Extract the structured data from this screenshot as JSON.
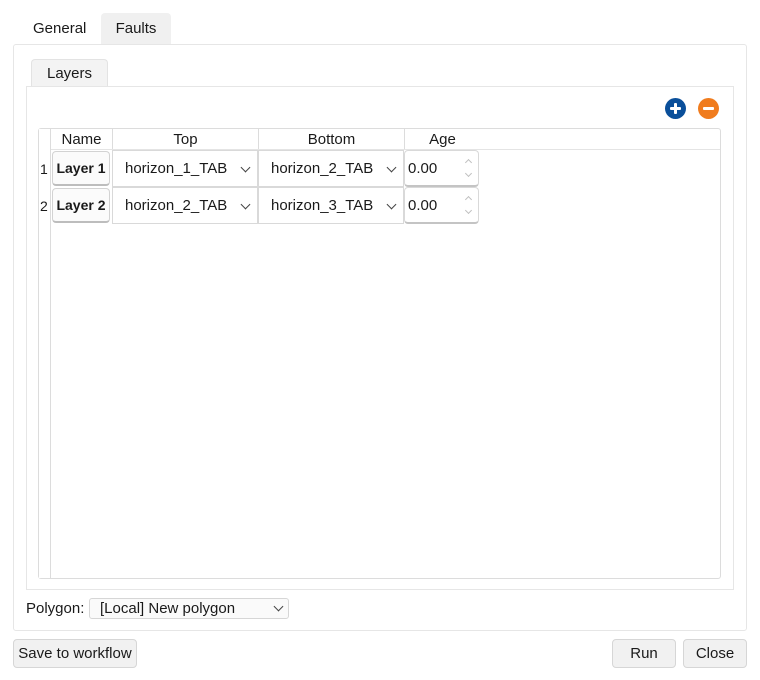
{
  "tabs": [
    {
      "label": "General",
      "active": false
    },
    {
      "label": "Faults",
      "active": true
    }
  ],
  "inner_tab": {
    "label": "Layers"
  },
  "toolbar": {
    "add_icon": "plus-circle-icon",
    "remove_icon": "minus-circle-icon",
    "add_color": "#0a4f9a",
    "remove_color": "#f07c1e"
  },
  "table": {
    "columns": [
      "Name",
      "Top",
      "Bottom",
      "Age"
    ],
    "rows": [
      {
        "index": "1",
        "name": "Layer 1",
        "top": "horizon_1_TAB",
        "bottom": "horizon_2_TAB",
        "age": "0.00"
      },
      {
        "index": "2",
        "name": "Layer 2",
        "top": "horizon_2_TAB",
        "bottom": "horizon_3_TAB",
        "age": "0.00"
      }
    ]
  },
  "polygon": {
    "label": "Polygon:",
    "value": "[Local] New polygon"
  },
  "buttons": {
    "save": "Save to workflow",
    "run": "Run",
    "close": "Close"
  }
}
